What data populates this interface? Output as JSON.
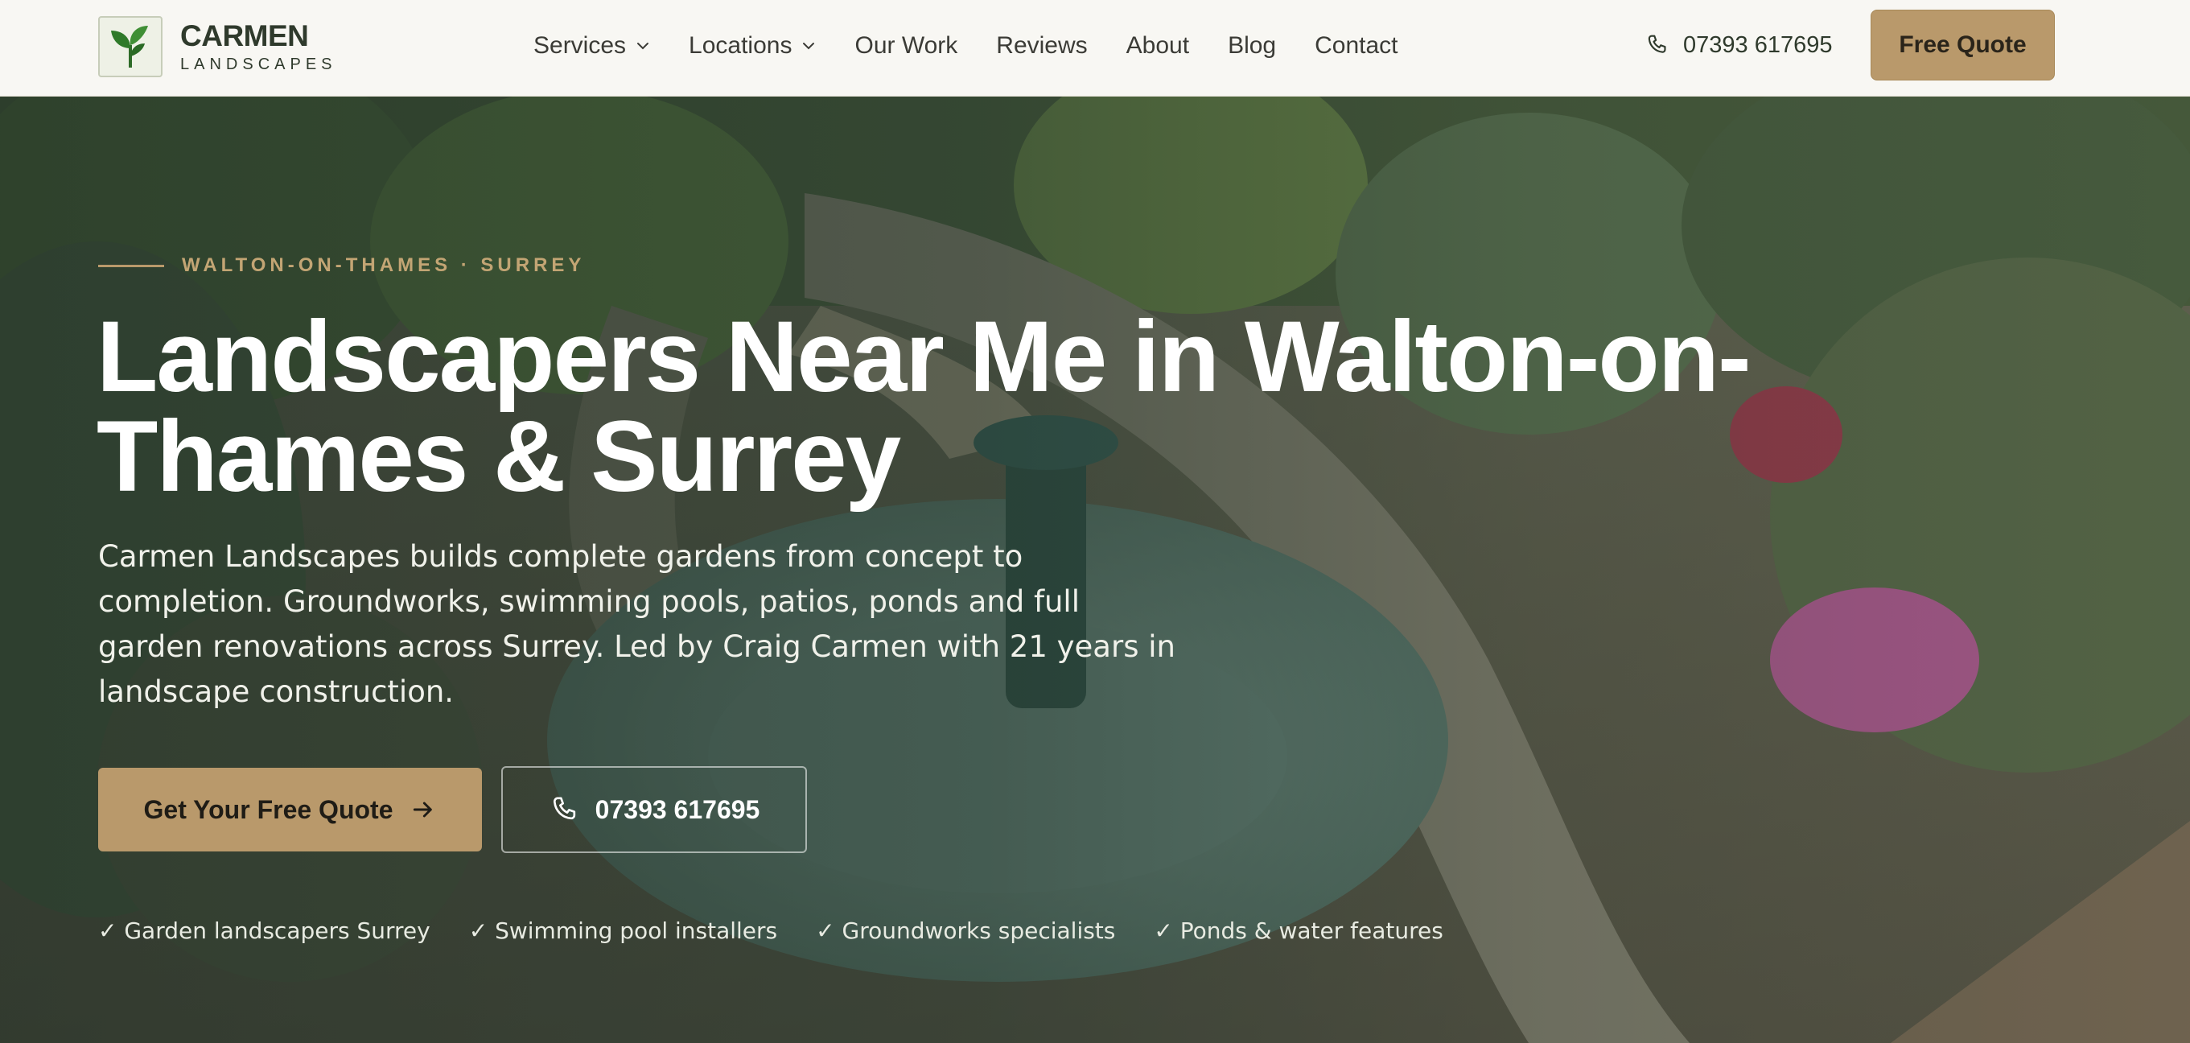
{
  "brand": {
    "name": "CARMEN",
    "tagline": "LANDSCAPES"
  },
  "nav": {
    "items": [
      {
        "label": "Services",
        "dropdown": true
      },
      {
        "label": "Locations",
        "dropdown": true
      },
      {
        "label": "Our Work",
        "dropdown": false
      },
      {
        "label": "Reviews",
        "dropdown": false
      },
      {
        "label": "About",
        "dropdown": false
      },
      {
        "label": "Blog",
        "dropdown": false
      },
      {
        "label": "Contact",
        "dropdown": false
      }
    ],
    "phone": "07393 617695",
    "cta": "Free Quote"
  },
  "hero": {
    "eyebrow": "WALTON-ON-THAMES · SURREY",
    "headline_line1": "Landscapers Near Me in Walton-on-",
    "headline_line2": "Thames & Surrey",
    "lede_line1": "Carmen Landscapes builds complete gardens from concept to",
    "lede_line2": "completion. Groundworks, swimming pools, patios, ponds and full",
    "lede_line3": "garden renovations across Surrey. Led by Craig Carmen with 21 years in",
    "lede_line4": "landscape construction.",
    "primary_cta": "Get Your Free Quote",
    "secondary_cta": "07393 617695",
    "badges": [
      "✓ Garden landscapers Surrey",
      "✓ Swimming pool installers",
      "✓ Groundworks specialists",
      "✓ Ponds & water features"
    ]
  },
  "colors": {
    "accent": "#b9996b",
    "dark_green": "#2f3a2c",
    "header_bg": "#f8f7f3"
  },
  "icons": {
    "logo": "leaf-sprout-icon",
    "dropdown": "chevron-down-icon",
    "phone": "phone-icon",
    "arrow": "arrow-right-icon"
  }
}
